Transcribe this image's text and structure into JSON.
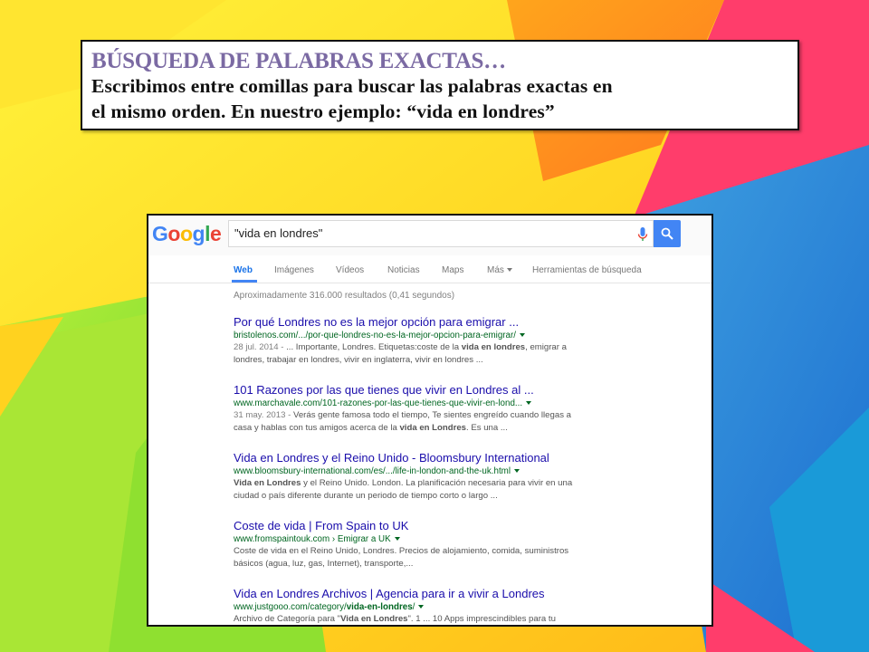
{
  "slide": {
    "title": "BÚSQUEDA DE PALABRAS EXACTAS…",
    "body_line1": "Escribimos entre comillas para buscar las palabras exactas en",
    "body_line2": "el mismo orden. En nuestro ejemplo: “vida en londres”"
  },
  "google": {
    "logo": "Google",
    "logo_colors": [
      "#4285f4",
      "#ea4335",
      "#fbbc05",
      "#4285f4",
      "#34a853",
      "#ea4335"
    ],
    "query": "\"vida en londres\"",
    "tabs": [
      "Web",
      "Imágenes",
      "Vídeos",
      "Noticias",
      "Maps",
      "Más",
      "Herramientas de búsqueda"
    ],
    "stats": "Aproximadamente 316.000 resultados (0,41 segundos)",
    "results": [
      {
        "title": "Por qué Londres no es la mejor opción para emigrar ...",
        "url": "bristolenos.com/.../por-que-londres-no-es-la-mejor-opcion-para-emigrar/",
        "date": "28 jul. 2014 -",
        "snippet1_a": " ... Importante, Londres. Etiquetas:coste de la ",
        "snippet1_b": "vida en londres",
        "snippet1_c": ", emigrar a",
        "snippet2": "londres, trabajar en londres, vivir en inglaterra, vivir en londres ..."
      },
      {
        "title": "101 Razones por las que tienes que vivir en Londres al ...",
        "url": "www.marchavale.com/101-razones-por-las-que-tienes-que-vivir-en-lond...",
        "date": "31 may. 2013 -",
        "snippet1_a": " Verás gente famosa todo el tiempo, Te sientes engreído cuando llegas a",
        "snippet2_a": "casa y hablas con tus amigos acerca de la ",
        "snippet2_b": "vida en Londres",
        "snippet2_c": ". Es una ..."
      },
      {
        "title": "Vida en Londres y el Reino Unido - Bloomsbury International",
        "url": "www.bloomsbury-international.com/es/.../life-in-london-and-the-uk.html",
        "snippet1_b": "Vida en Londres",
        "snippet1_c": " y el Reino Unido. London. La planificación necesaria para vivir en una",
        "snippet2": "ciudad o país diferente durante un periodo de tiempo corto o largo ..."
      },
      {
        "title": "Coste de vida | From Spain to UK",
        "url": "www.fromspaintouk.com › Emigrar a UK",
        "snippet1": "Coste de vida en el Reino Unido, Londres. Precios de alojamiento, comida, suministros",
        "snippet2": "básicos (agua, luz, gas, Internet), transporte,..."
      },
      {
        "title": "Vida en Londres Archivos | Agencia para ir a vivir a Londres",
        "url_a": "www.justgooo.com/category/",
        "url_b": "vida-en-londres",
        "url_c": "/",
        "snippet1_a": "Archivo de Categoría para \"",
        "snippet1_b": "Vida en Londres",
        "snippet1_c": "\". 1 ... 10 Apps imprescindibles para tu"
      }
    ]
  }
}
